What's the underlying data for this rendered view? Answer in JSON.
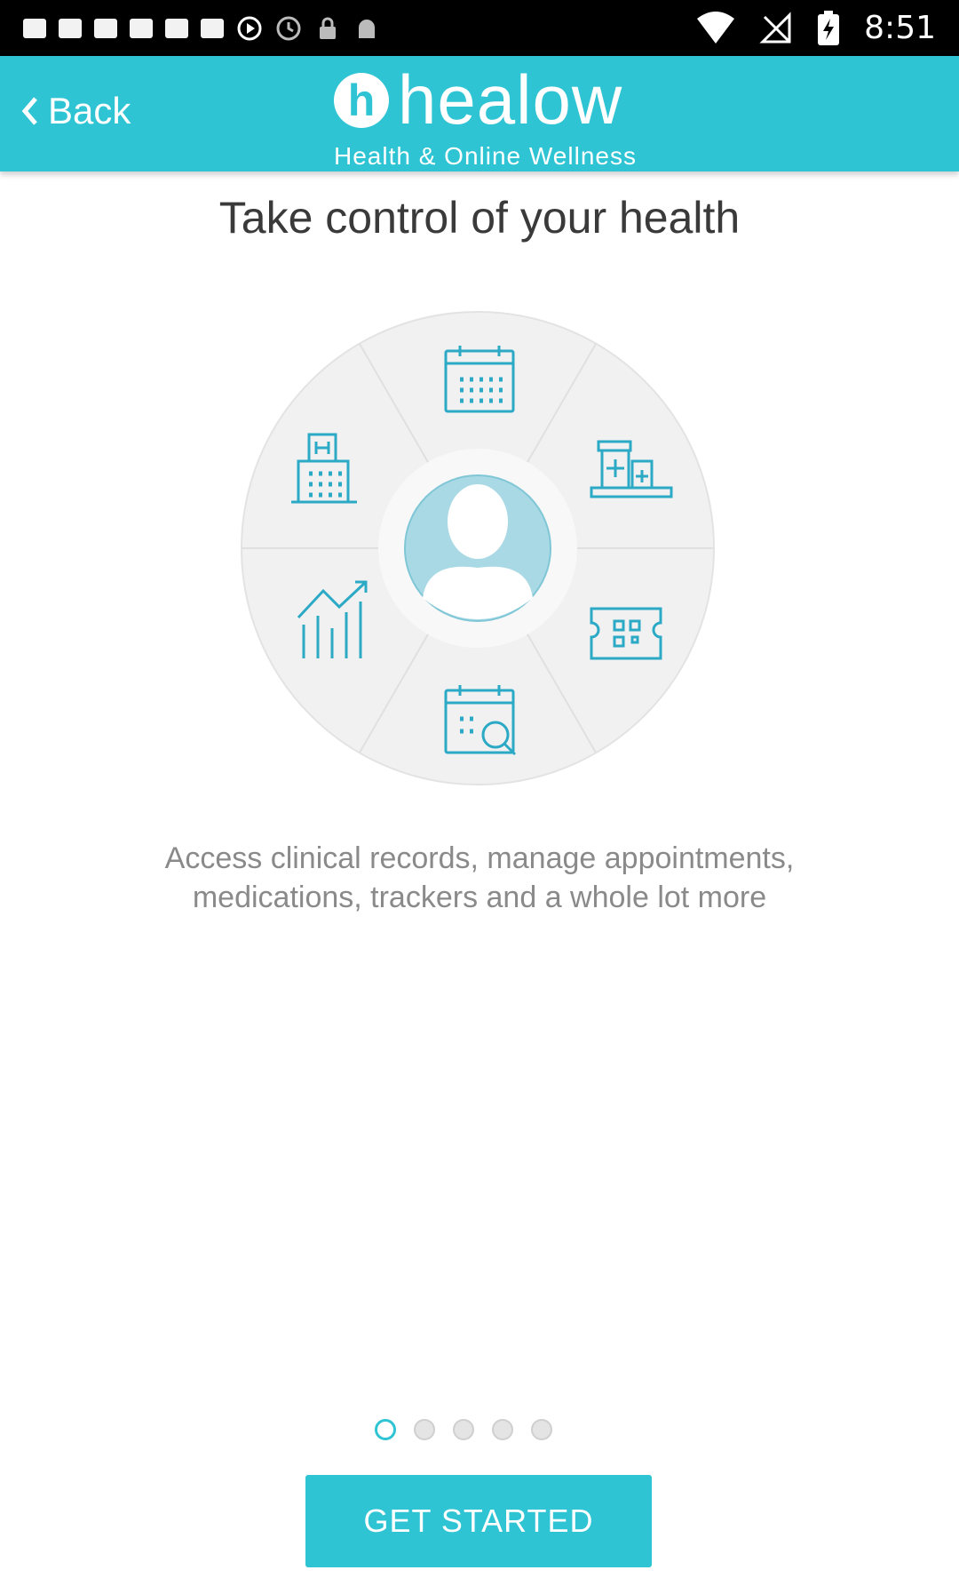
{
  "status_bar": {
    "time": "8:51",
    "icons": [
      "notification-icon",
      "notification-icon",
      "notification-icon",
      "notification-icon",
      "notification-icon",
      "notification-icon",
      "play-icon",
      "clock-icon",
      "lock-icon",
      "android-icon",
      "wifi-icon",
      "no-signal-icon",
      "battery-charging-icon"
    ]
  },
  "header": {
    "back_label": "Back",
    "logo_text": "healow",
    "logo_sub": "Health & Online Wellness",
    "accent": "#2ec4d4"
  },
  "main": {
    "headline": "Take control of your health",
    "description": "Access clinical records, manage appointments, medications, trackers and a whole lot more",
    "wheel_icons": [
      "calendar-icon",
      "pharmacy-icon",
      "ticket-icon",
      "calendar-search-icon",
      "chart-icon",
      "hospital-icon",
      "user-avatar-icon"
    ]
  },
  "pager": {
    "count": 5,
    "active": 1
  },
  "cta": {
    "label": "GET STARTED"
  }
}
